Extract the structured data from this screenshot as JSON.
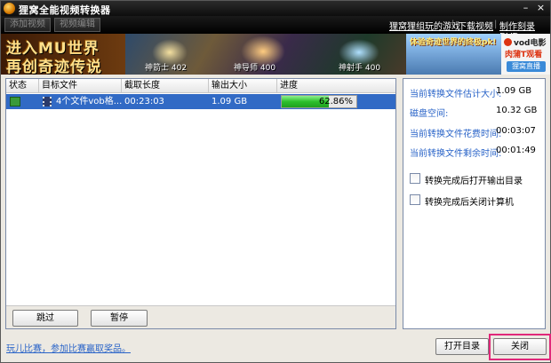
{
  "window": {
    "title": "狸窝全能视频转换器"
  },
  "toolbar": {
    "add_video": "添加视频",
    "edit_video": "视频编辑",
    "links": [
      "狸窝狸组玩的游戏",
      "下载视频",
      "制作刻录DVD"
    ]
  },
  "banner": {
    "line1": "进入MU世界",
    "line2": "再创奇迹传说",
    "tags": [
      "神箭士 402",
      "神导师 400",
      "神射手 400"
    ],
    "slogan": "体验奇迹世界的终极pk!",
    "vod_brand": "vod电影",
    "vod_sub": "肉蒲T观看",
    "vod_button": "狸窝直播"
  },
  "list": {
    "columns": [
      "状态",
      "目标文件",
      "截取长度",
      "输出大小",
      "进度"
    ],
    "rows": [
      {
        "target": "4个文件vob格...",
        "duration": "00:23:03",
        "size": "1.09 GB",
        "progress_text": "62.86%",
        "progress": 62.86
      }
    ],
    "skip_label": "跳过",
    "pause_label": "暂停"
  },
  "info": {
    "items": [
      {
        "label": "当前转换文件估计大小:",
        "value": "1.09 GB"
      },
      {
        "label": "磁盘空间:",
        "value": "10.32 GB"
      },
      {
        "label": "当前转换文件花费时间:",
        "value": "00:03:07"
      },
      {
        "label": "当前转换文件剩余时间:",
        "value": "00:01:49"
      }
    ],
    "options": [
      "转换完成后打开输出目录",
      "转换完成后关闭计算机"
    ]
  },
  "footer": {
    "link": "玩儿比赛，参加比赛赢取奖品。",
    "open_dir": "打开目录",
    "close": "关闭"
  },
  "colors": {
    "selection": "#316ac5",
    "link": "#2a64c8",
    "progress": "#2cbf2c",
    "highlight": "#e0287a"
  }
}
